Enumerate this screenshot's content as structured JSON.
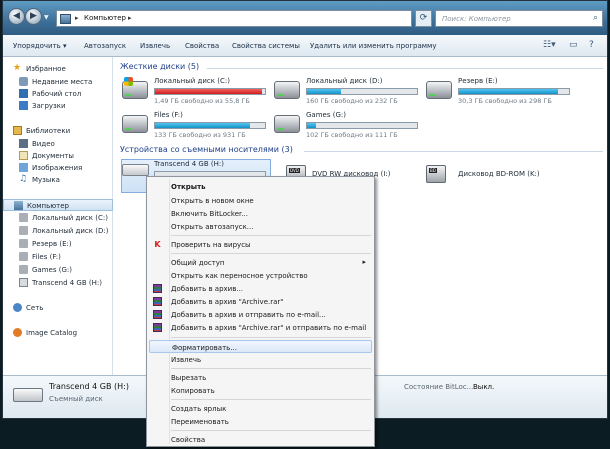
{
  "address": {
    "crumb": "Компьютер",
    "search_placeholder": "Поиск: Компьютер"
  },
  "toolbar": {
    "organize": "Упорядочить ▾",
    "autoplay": "Автозапуск",
    "eject": "Извлечь",
    "properties": "Свойства",
    "system_properties": "Свойства системы",
    "uninstall": "Удалить или изменить программу"
  },
  "sidebar": {
    "favorites": "Избранное",
    "recent": "Недавние места",
    "desktop": "Рабочий стол",
    "downloads": "Загрузки",
    "libraries": "Библиотеки",
    "video": "Видео",
    "documents": "Документы",
    "images": "Изображения",
    "music": "Музыка",
    "computer": "Компьютер",
    "drive_c": "Локальный диск (C:)",
    "drive_d": "Локальный диск (D:)",
    "drive_e": "Резерв (E:)",
    "drive_f": "Files (F:)",
    "drive_g": "Games (G:)",
    "drive_h": "Transcend 4 GB (H:)",
    "network": "Сеть",
    "image_catalog": "Image Catalog"
  },
  "sections": {
    "hdd": "Жесткие диски (5)",
    "removable": "Устройства со съемными носителями (3)"
  },
  "drives": {
    "c": {
      "name": "Локальный диск (C:)",
      "free": "1,49 ГБ свободно из 55,8 ГБ",
      "used_fraction": 0.97
    },
    "d": {
      "name": "Локальный диск (D:)",
      "free": "160 ГБ свободно из 232 ГБ",
      "used_fraction": 0.31
    },
    "e": {
      "name": "Резерв (E:)",
      "free": "30,3 ГБ свободно из 298 ГБ",
      "used_fraction": 0.9
    },
    "f": {
      "name": "Files (F:)",
      "free": "133 ГБ свободно из 931 ГБ",
      "used_fraction": 0.86
    },
    "g": {
      "name": "Games (G:)",
      "free": "102 ГБ свободно из 111 ГБ",
      "used_fraction": 0.08
    }
  },
  "removable": {
    "usb": {
      "name": "Transcend 4 GB (H:)"
    },
    "dvd": {
      "name": "DVD RW дисковод (I:)"
    },
    "bd": {
      "name": "Дисковод BD-ROM (K:)"
    }
  },
  "context_menu": {
    "open": "Открыть",
    "open_new_window": "Открыть в новом окне",
    "bitlocker": "Включить BitLocker...",
    "autoplay": "Открыть автозапуск...",
    "scan": "Проверить на вирусы",
    "share": "Общий доступ",
    "portable": "Открыть как переносное устройство",
    "add_archive": "Добавить в архив...",
    "add_archive_rar": "Добавить в архив \"Archive.rar\"",
    "add_archive_email": "Добавить в архив и отправить по e-mail...",
    "add_archive_rar_email": "Добавить в архив \"Archive.rar\" и отправить по e-mail",
    "format": "Форматировать...",
    "eject": "Извлечь",
    "cut": "Вырезать",
    "copy": "Копировать",
    "shortcut": "Создать ярлык",
    "rename": "Переименовать",
    "properties": "Свойства"
  },
  "details": {
    "title": "Transcend 4 GB (H:)",
    "type": "Съемный диск",
    "bitlocker_label": "Состояние BitLoc...",
    "bitlocker_value": "Выкл."
  },
  "colors": {
    "bar_normal": "#26a7dc",
    "bar_full": "#e02b2b",
    "selection": "#cde2f7"
  }
}
